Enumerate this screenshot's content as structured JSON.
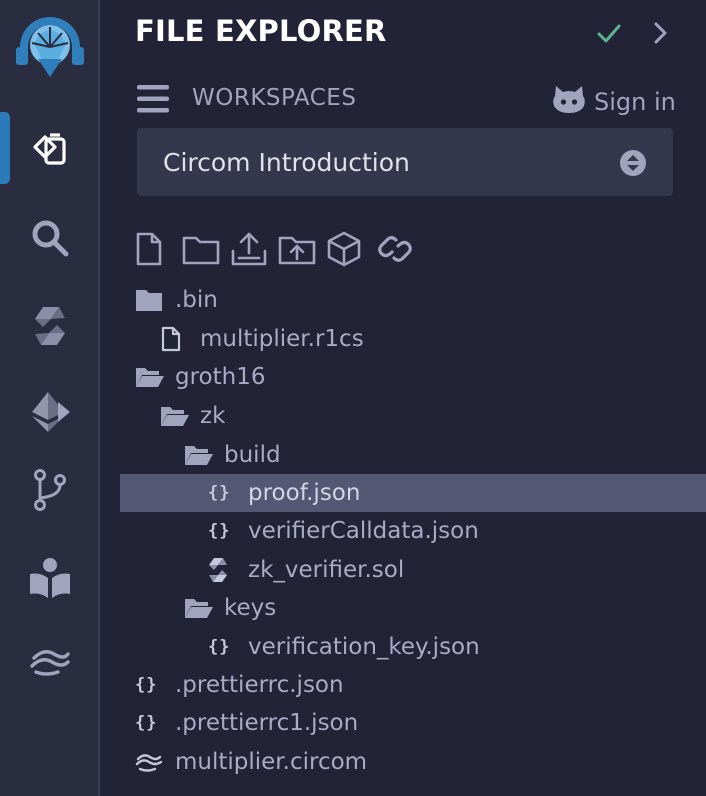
{
  "panel": {
    "title": "FILE EXPLORER",
    "workspaces_label": "WORKSPACES",
    "sign_in_label": "Sign in",
    "selected_workspace": "Circom Introduction"
  },
  "rail": {
    "items": [
      "remix-logo-icon",
      "file-explorer-icon",
      "search-icon",
      "solidity-compiler-icon",
      "deploy-run-icon",
      "git-icon",
      "learneth-icon",
      "circom-icon"
    ],
    "active": "file-explorer-icon"
  },
  "toolbar": {
    "items": [
      "new-file-icon",
      "new-folder-icon",
      "publish-gist-icon",
      "upload-file-icon",
      "upload-folder-icon",
      "link-icon"
    ]
  },
  "tree": {
    "items": [
      {
        "label": ".bin",
        "type": "folder-closed"
      },
      {
        "label": "multiplier.r1cs",
        "type": "file"
      },
      {
        "label": "groth16",
        "type": "folder-open"
      },
      {
        "label": "zk",
        "type": "folder-open"
      },
      {
        "label": "build",
        "type": "folder-open"
      },
      {
        "label": "proof.json",
        "type": "json",
        "selected": true
      },
      {
        "label": "verifierCalldata.json",
        "type": "json"
      },
      {
        "label": "zk_verifier.sol",
        "type": "solidity"
      },
      {
        "label": "keys",
        "type": "folder-open"
      },
      {
        "label": "verification_key.json",
        "type": "json"
      },
      {
        "label": ".prettierrc.json",
        "type": "json"
      },
      {
        "label": ".prettierrc1.json",
        "type": "json"
      },
      {
        "label": "multiplier.circom",
        "type": "circom"
      }
    ]
  },
  "colors": {
    "background": "#222336",
    "rail": "#2a2c3f",
    "accent": "#2a79b8",
    "check": "#5cb38c",
    "selected_row": "#555874",
    "select_bg": "#35384c"
  }
}
